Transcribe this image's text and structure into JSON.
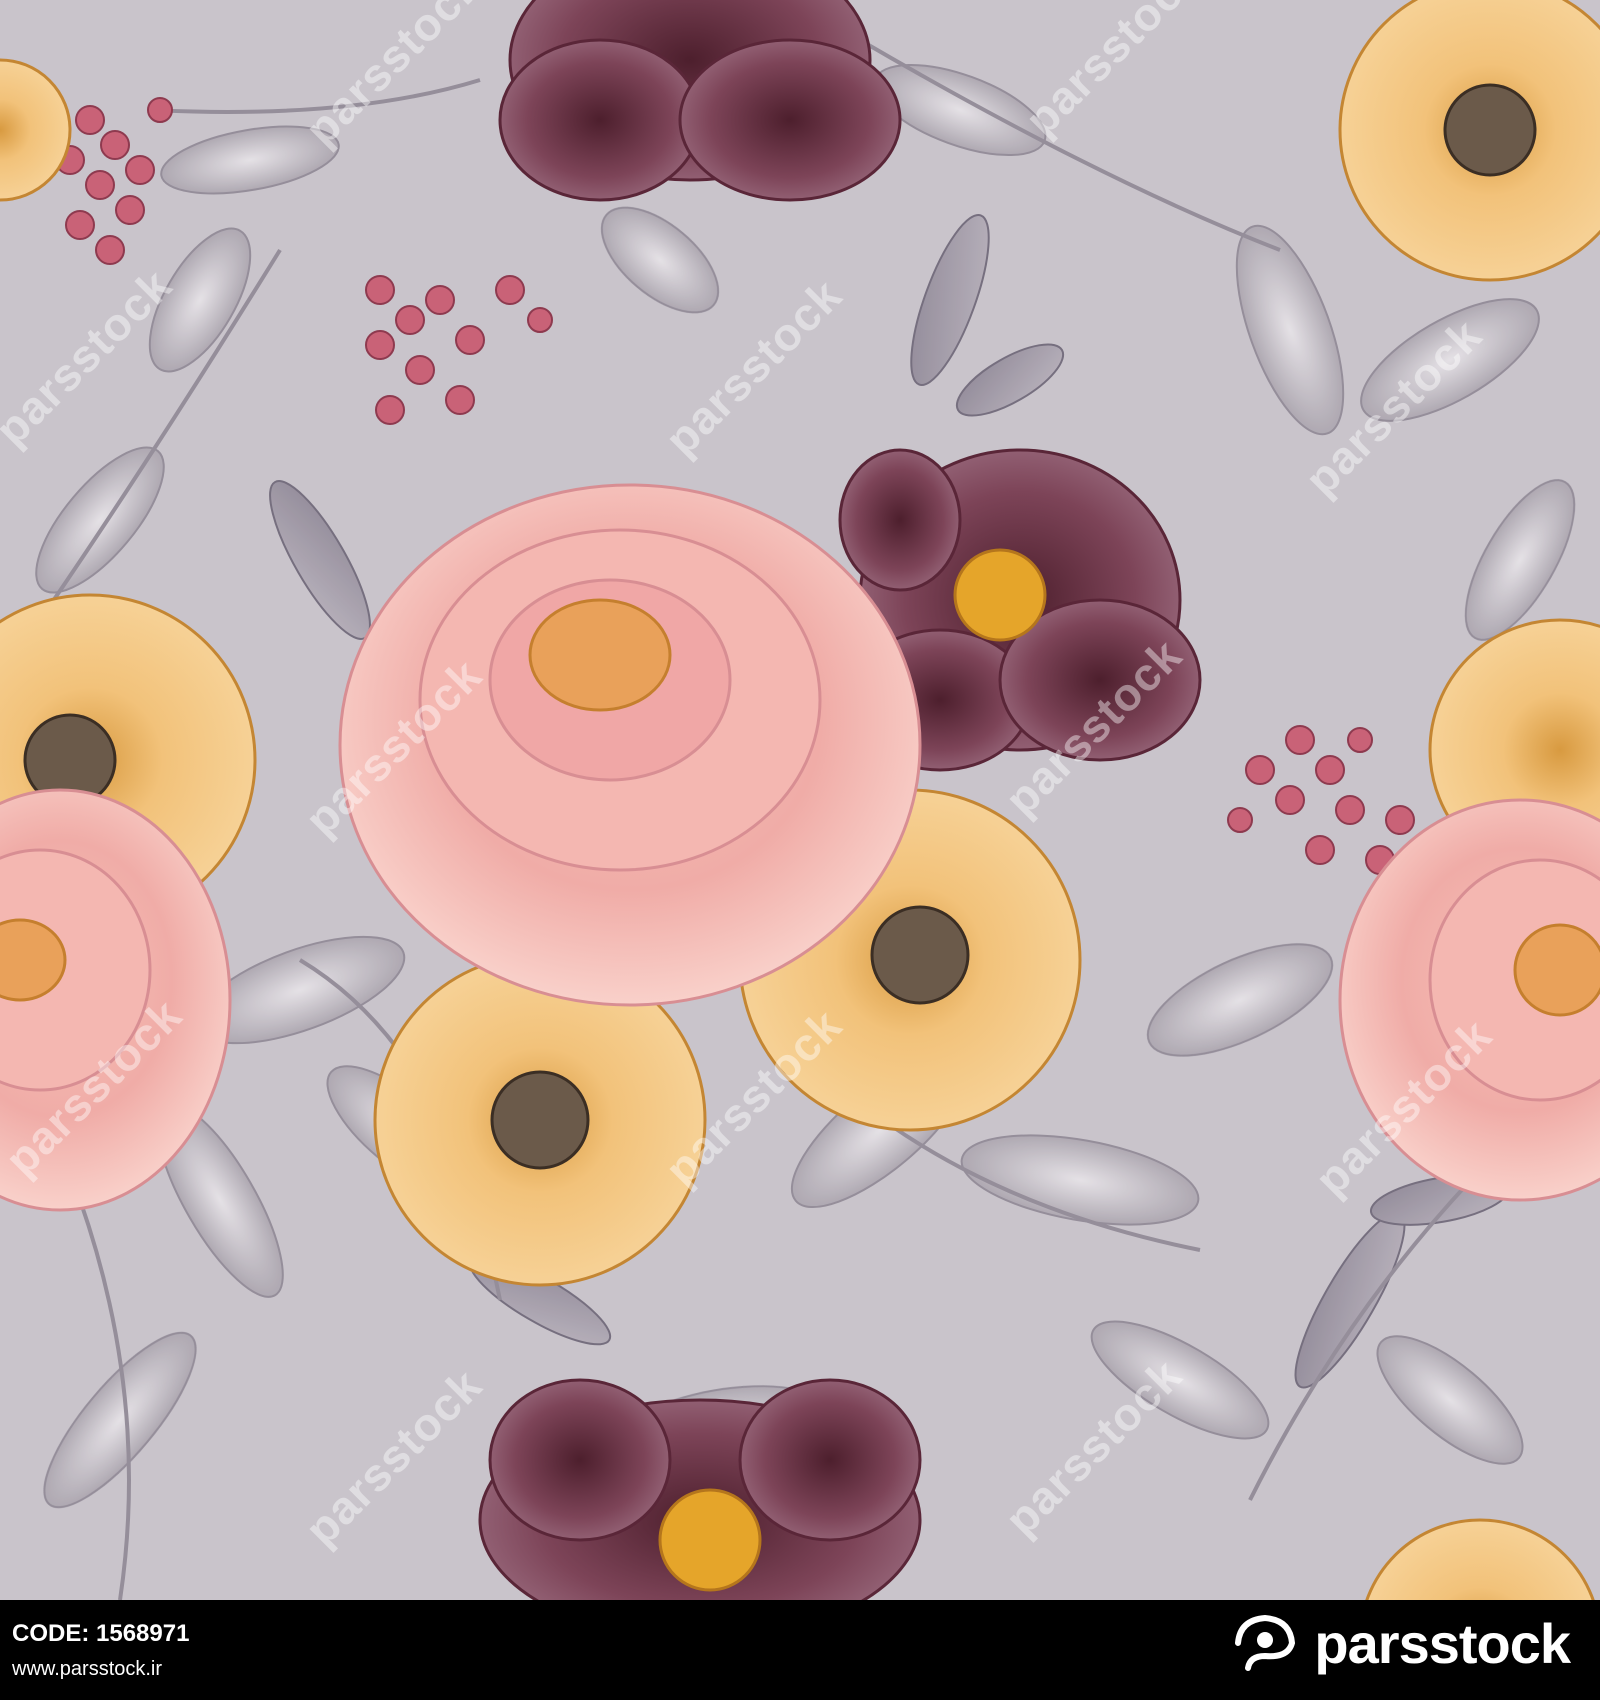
{
  "image": {
    "description_colors": {
      "background": "#c9c4cb",
      "pink_rose": "#f2b3ab",
      "burgundy": "#7a3d52",
      "yellow": "#f0c06e",
      "leaf_gray": "#a9a3ab",
      "berry_pink": "#c96277"
    }
  },
  "watermark": {
    "text": "parsstock"
  },
  "footer": {
    "code_label": "CODE:",
    "code_value": "1568971",
    "site": "www.parsstock.ir",
    "brand": "parsstock"
  }
}
